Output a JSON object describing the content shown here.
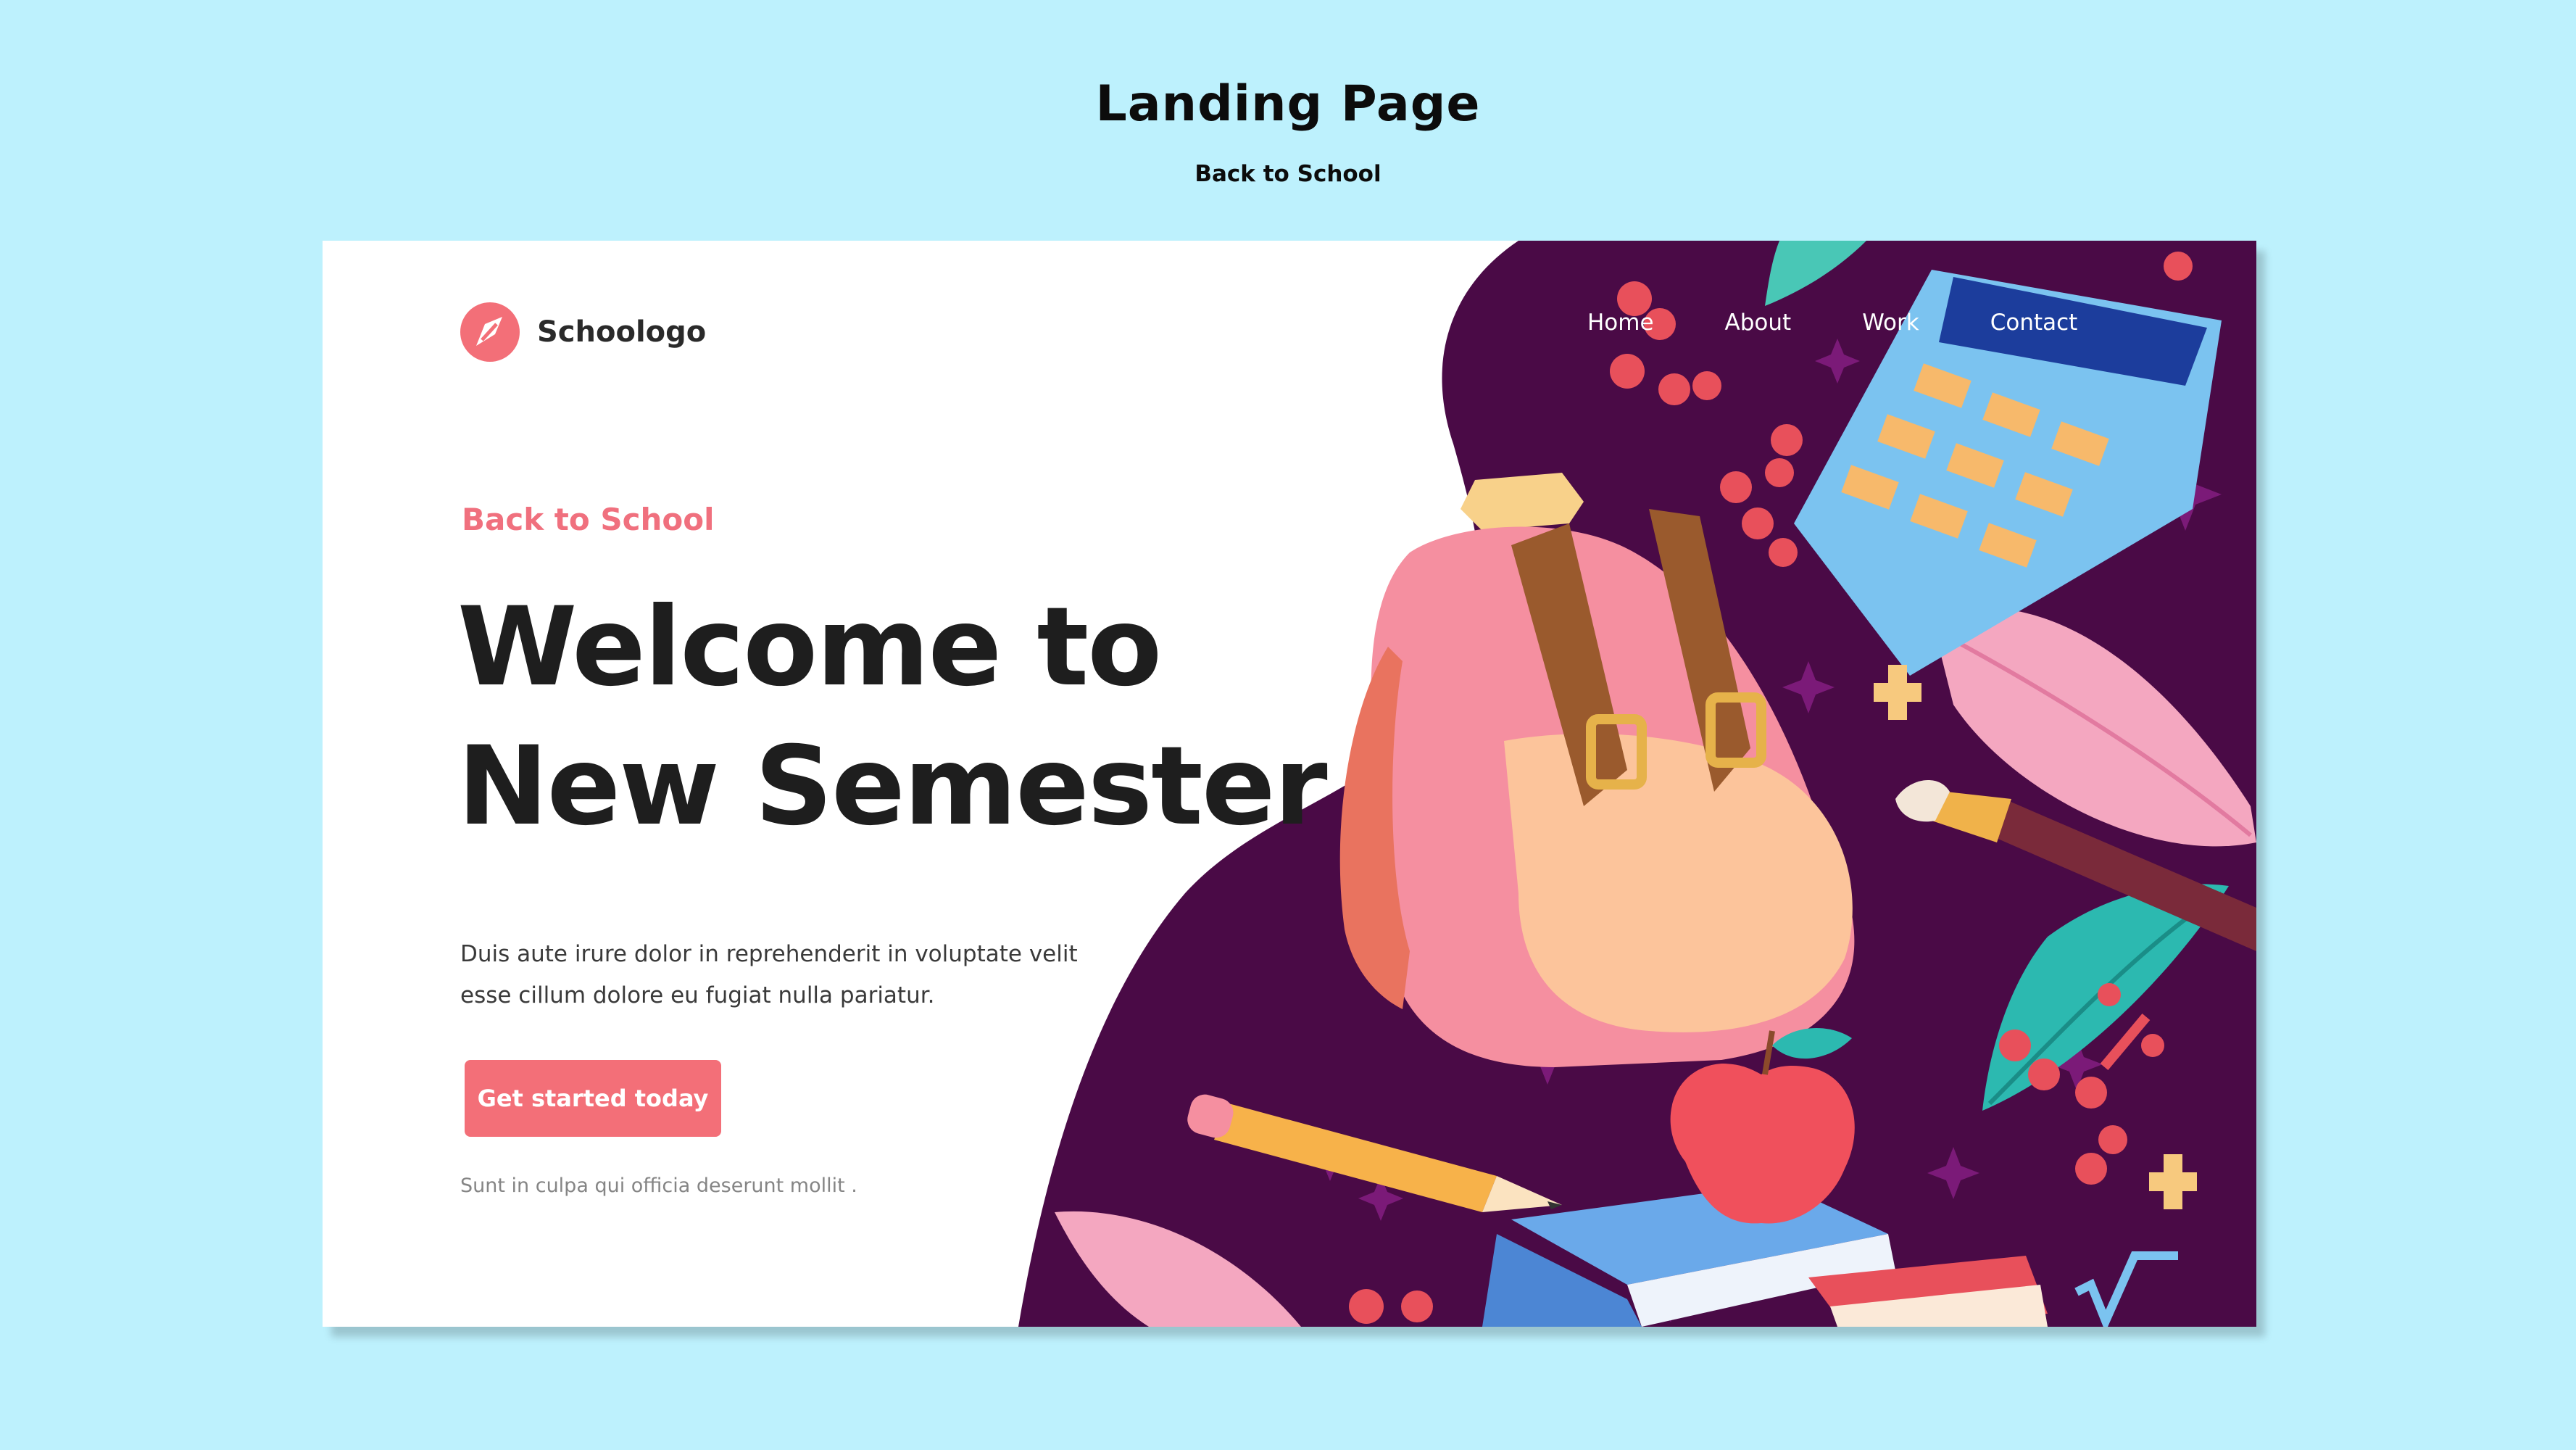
{
  "frame": {
    "title": "Landing Page",
    "subtitle": "Back to School"
  },
  "brand": {
    "name": "Schoologo",
    "logo_icon": "pencil-circle-icon"
  },
  "nav": {
    "items": [
      {
        "label": "Home"
      },
      {
        "label": "About"
      },
      {
        "label": "Work"
      },
      {
        "label": "Contact"
      }
    ]
  },
  "hero": {
    "eyebrow": "Back to School",
    "headline_line1": "Welcome to",
    "headline_line2": "New Semester",
    "body": "Duis aute irure dolor in reprehenderit in voluptate velit esse cillum dolore eu fugiat nulla pariatur.",
    "cta_label": "Get started today",
    "footnote": "Sunt in culpa qui officia deserunt mollit ."
  },
  "illustration": {
    "icons": [
      "backpack-icon",
      "calculator-icon",
      "pencil-icon",
      "apple-icon",
      "books-icon",
      "paintbrush-icon",
      "leaf-icon",
      "berries-icon",
      "star-icon",
      "plus-icon",
      "percent-icon",
      "sqrt-icon"
    ]
  },
  "colors": {
    "page_background": "#bdf1fd",
    "card_background": "#ffffff",
    "accent": "#f36f78",
    "eyebrow": "#f0707e",
    "blob": "#4a0a46",
    "headline": "#1e1e1e"
  }
}
